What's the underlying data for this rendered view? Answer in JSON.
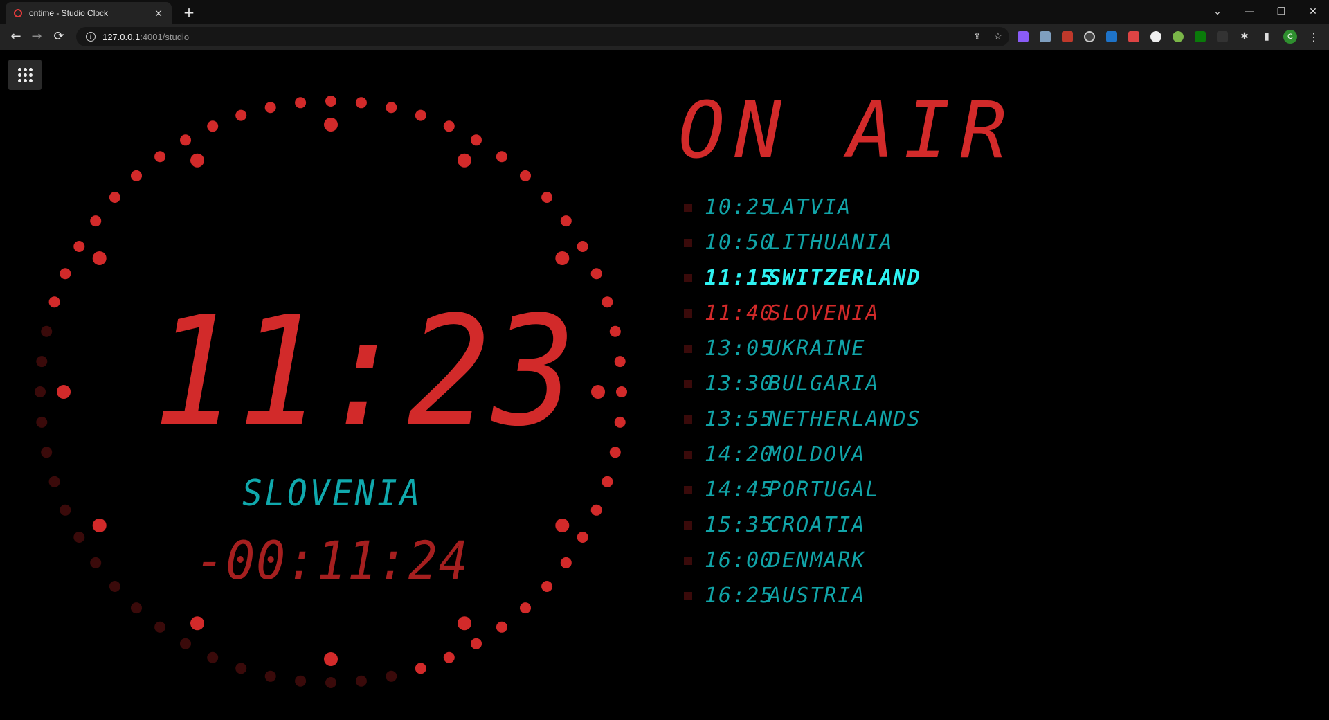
{
  "browser": {
    "tab_title": "ontime - Studio Clock",
    "tab_close": "×",
    "new_tab": "+",
    "url_host": "127.0.0.1",
    "url_path": ":4001/studio",
    "profile_initial": "C",
    "window_controls": {
      "tab_search": "⌄",
      "minimize": "—",
      "restore": "❐",
      "close": "✕"
    },
    "nav": {
      "back": "←",
      "forward": "→",
      "reload": "⟳"
    },
    "icons": [
      "share-icon",
      "star-icon",
      "puzzle-icon",
      "side-panel-icon",
      "menu-icon"
    ]
  },
  "studio": {
    "clock_time": "11:23",
    "clock_title": "SLOVENIA",
    "countdown": "-00:11:24",
    "on_air_label": "ON AIR",
    "colors": {
      "active": "#d22a2a",
      "inactive_dot": "#3a0a0a",
      "event_default": "#11a4a8",
      "event_next": "#2ff2f2",
      "background": "#000000"
    },
    "seconds_elapsed_dots": 60
  },
  "schedule": [
    {
      "time": "10:25",
      "title": "LATVIA"
    },
    {
      "time": "10:50",
      "title": "LITHUANIA"
    },
    {
      "time": "11:15",
      "title": "SWITZERLAND"
    },
    {
      "time": "11:40",
      "title": "SLOVENIA"
    },
    {
      "time": "13:05",
      "title": "UKRAINE"
    },
    {
      "time": "13:30",
      "title": "BULGARIA"
    },
    {
      "time": "13:55",
      "title": "NETHERLANDS"
    },
    {
      "time": "14:20",
      "title": "MOLDOVA"
    },
    {
      "time": "14:45",
      "title": "PORTUGAL"
    },
    {
      "time": "15:35",
      "title": "CROATIA"
    },
    {
      "time": "16:00",
      "title": "DENMARK"
    },
    {
      "time": "16:25",
      "title": "AUSTRIA"
    }
  ]
}
